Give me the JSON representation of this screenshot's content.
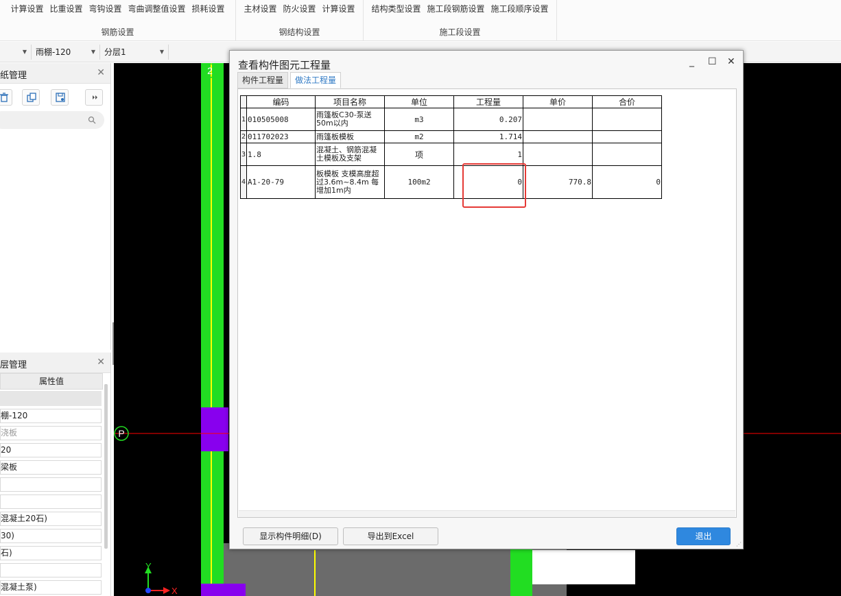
{
  "ribbon": {
    "groups": [
      {
        "label": "钢筋设置",
        "buttons": [
          "计算设置",
          "比重设置",
          "弯钩设置",
          "弯曲调整值设置",
          "损耗设置"
        ]
      },
      {
        "label": "钢结构设置",
        "buttons": [
          "主材设置",
          "防火设置",
          "计算设置"
        ]
      },
      {
        "label": "施工段设置",
        "buttons": [
          "结构类型设置",
          "施工段钢筋设置",
          "施工段顺序设置"
        ]
      }
    ]
  },
  "toolbar": {
    "component": "雨棚-120",
    "layer": "分层1"
  },
  "drawing_panel": {
    "title": "纸管理"
  },
  "layer_panel": {
    "title": "层管理",
    "attr_header": "属性值",
    "rows": [
      "棚-120",
      "浇板",
      "20",
      "梁板",
      "",
      "",
      "混凝土20石)",
      "30)",
      "石)",
      "",
      "混凝土泵)"
    ]
  },
  "canvas": {
    "axis_2": "2",
    "axis_p": "P",
    "axis_x": "X",
    "axis_y": "Y"
  },
  "dialog": {
    "title": "查看构件图元工程量",
    "tabs": [
      "构件工程量",
      "做法工程量"
    ],
    "active_tab": "做法工程量",
    "table": {
      "headers": [
        "编码",
        "项目名称",
        "单位",
        "工程量",
        "单价",
        "合价"
      ],
      "rows": [
        {
          "n": "1",
          "code": "010505008",
          "name": "雨篷板C30-泵送50m以内",
          "unit": "m3",
          "qty": "0.207",
          "price": "",
          "total": ""
        },
        {
          "n": "2",
          "code": "011702023",
          "name": "雨篷板模板",
          "unit": "m2",
          "qty": "1.714",
          "price": "",
          "total": ""
        },
        {
          "n": "3",
          "code": "1.8",
          "name": "混凝土、钢筋混凝土模板及支架",
          "unit": "项",
          "qty": "1",
          "price": "",
          "total": ""
        },
        {
          "n": "4",
          "code": "A1-20-79",
          "name": "板模板 支模高度超过3.6m~8.4m 每增加1m内",
          "unit": "100m2",
          "qty": "0",
          "price": "770.8",
          "total": "0"
        }
      ]
    },
    "buttons": {
      "show_detail": "显示构件明细(D)",
      "export_excel": "导出到Excel",
      "exit": "退出"
    },
    "controls": {
      "minimize": "_",
      "maximize": "☐",
      "close": "✕"
    }
  },
  "colors": {
    "highlight": "#e53935",
    "primary_button": "#2f88df",
    "active_tab": "#2f79c4",
    "beam_green": "#22dd22",
    "slab_purple": "#8800ee"
  }
}
